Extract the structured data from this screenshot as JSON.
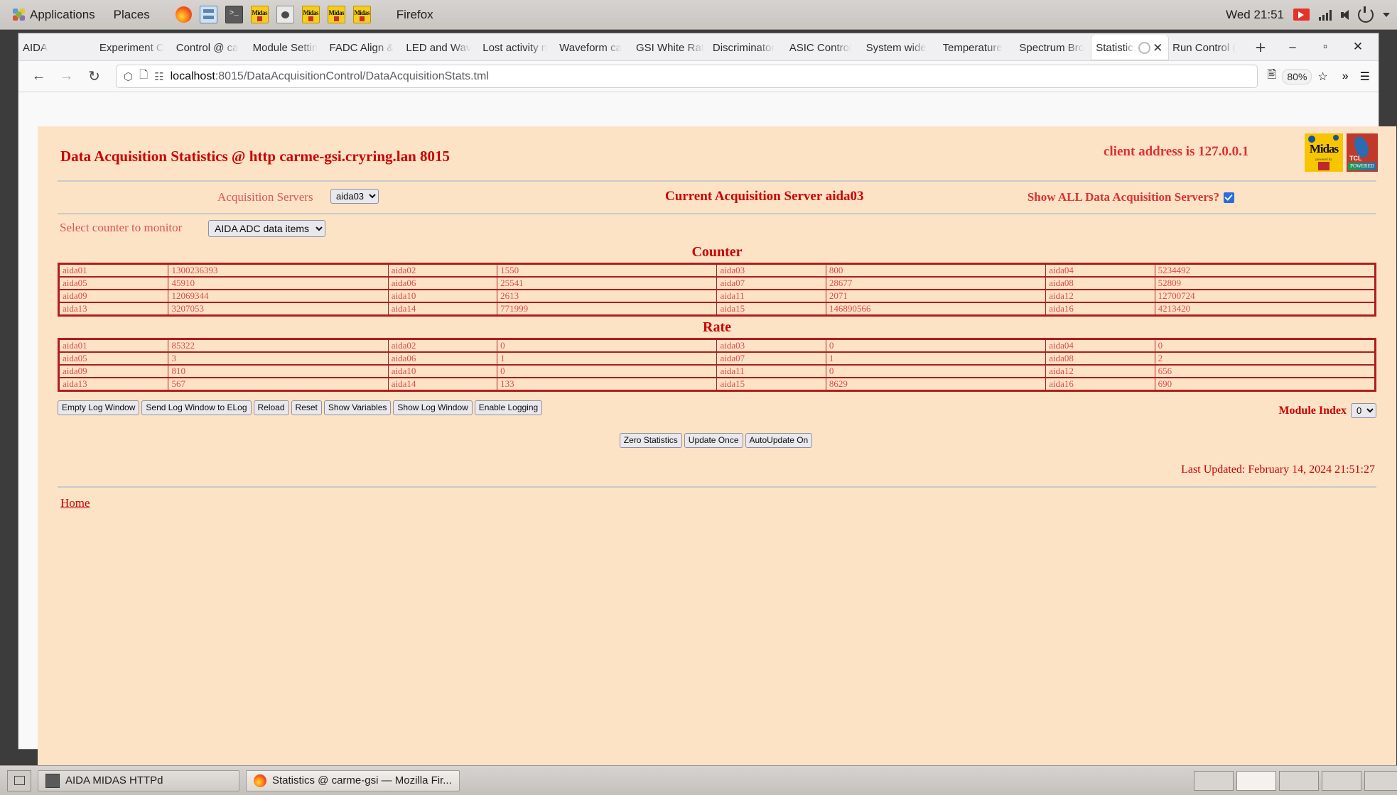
{
  "desktop": {
    "applications_label": "Applications",
    "places_label": "Places",
    "active_app_label": "Firefox",
    "clock": "Wed 21:51",
    "panel_icons": [
      "firefox-icon",
      "files-icon",
      "terminal-icon",
      "midas-icon",
      "screenshot-icon",
      "midas-icon",
      "midas-icon",
      "midas-icon"
    ],
    "tray_icons": [
      "recording-indicator-icon",
      "network-icon",
      "volume-icon",
      "power-icon",
      "chevron-down-icon"
    ]
  },
  "browser": {
    "tabs": [
      {
        "label": "AIDA",
        "active": false
      },
      {
        "label": "Experiment C",
        "active": false
      },
      {
        "label": "Control @ ca",
        "active": false
      },
      {
        "label": "Module Settin",
        "active": false
      },
      {
        "label": "FADC Align &",
        "active": false
      },
      {
        "label": "LED and Wav",
        "active": false
      },
      {
        "label": "Lost activity n",
        "active": false
      },
      {
        "label": "Waveform ca",
        "active": false
      },
      {
        "label": "GSI White Rat",
        "active": false
      },
      {
        "label": "Discriminator",
        "active": false
      },
      {
        "label": "ASIC Control",
        "active": false
      },
      {
        "label": "System wide",
        "active": false
      },
      {
        "label": "Temperature",
        "active": false
      },
      {
        "label": "Spectrum Bro",
        "active": false
      },
      {
        "label": "Statistics @",
        "active": true
      },
      {
        "label": "Run Control (",
        "active": false
      }
    ],
    "new_tab_label": "+",
    "window_controls": {
      "minimize": "–",
      "maximize": "▫",
      "close": "✕"
    },
    "url_host": "localhost",
    "url_rest": ":8015/DataAcquisitionControl/DataAcquisitionStats.tml",
    "zoom_level": "80%",
    "nav": {
      "back": "←",
      "forward": "→",
      "reload": "↻"
    }
  },
  "page": {
    "title": "Data Acquisition Statistics @ http carme-gsi.cryring.lan 8015",
    "client_address": "client address is 127.0.0.1",
    "acquisition_servers_label": "Acquisition Servers",
    "acquisition_servers_value": "aida03",
    "current_acquisition_server": "Current Acquisition Server aida03",
    "show_all_label": "Show ALL Data Acquisition Servers?",
    "show_all_checked": true,
    "select_counter_label": "Select counter to monitor",
    "select_counter_value": "AIDA ADC data items",
    "counter_title": "Counter",
    "rate_title": "Rate",
    "counter_rows": [
      [
        {
          "name": "aida01",
          "value": "1300236393"
        },
        {
          "name": "aida02",
          "value": "1550"
        },
        {
          "name": "aida03",
          "value": "800"
        },
        {
          "name": "aida04",
          "value": "5234492"
        }
      ],
      [
        {
          "name": "aida05",
          "value": "45910"
        },
        {
          "name": "aida06",
          "value": "25541"
        },
        {
          "name": "aida07",
          "value": "28677"
        },
        {
          "name": "aida08",
          "value": "52809"
        }
      ],
      [
        {
          "name": "aida09",
          "value": "12069344"
        },
        {
          "name": "aida10",
          "value": "2613"
        },
        {
          "name": "aida11",
          "value": "2071"
        },
        {
          "name": "aida12",
          "value": "12700724"
        }
      ],
      [
        {
          "name": "aida13",
          "value": "3207053"
        },
        {
          "name": "aida14",
          "value": "771999"
        },
        {
          "name": "aida15",
          "value": "146890566"
        },
        {
          "name": "aida16",
          "value": "4213420"
        }
      ]
    ],
    "rate_rows": [
      [
        {
          "name": "aida01",
          "value": "85322"
        },
        {
          "name": "aida02",
          "value": "0"
        },
        {
          "name": "aida03",
          "value": "0"
        },
        {
          "name": "aida04",
          "value": "0"
        }
      ],
      [
        {
          "name": "aida05",
          "value": "3"
        },
        {
          "name": "aida06",
          "value": "1"
        },
        {
          "name": "aida07",
          "value": "1"
        },
        {
          "name": "aida08",
          "value": "2"
        }
      ],
      [
        {
          "name": "aida09",
          "value": "810"
        },
        {
          "name": "aida10",
          "value": "0"
        },
        {
          "name": "aida11",
          "value": "0"
        },
        {
          "name": "aida12",
          "value": "656"
        }
      ],
      [
        {
          "name": "aida13",
          "value": "567"
        },
        {
          "name": "aida14",
          "value": "133"
        },
        {
          "name": "aida15",
          "value": "8629"
        },
        {
          "name": "aida16",
          "value": "690"
        }
      ]
    ],
    "buttons_left": [
      "Empty Log Window",
      "Send Log Window to ELog",
      "Reload",
      "Reset",
      "Show Variables",
      "Show Log Window",
      "Enable Logging"
    ],
    "buttons_center": [
      "Zero Statistics",
      "Update Once",
      "AutoUpdate On"
    ],
    "module_index_label": "Module Index",
    "module_index_value": "0",
    "last_updated": "Last Updated: February 14, 2024 21:51:27",
    "home_link": "Home"
  },
  "taskbar": {
    "items": [
      {
        "label": "AIDA MIDAS HTTPd",
        "icon": "terminal-icon",
        "active": false
      },
      {
        "label": "Statistics @ carme-gsi — Mozilla Fir...",
        "icon": "firefox-icon",
        "active": true
      }
    ],
    "workspaces": 5,
    "current_workspace": 2
  }
}
